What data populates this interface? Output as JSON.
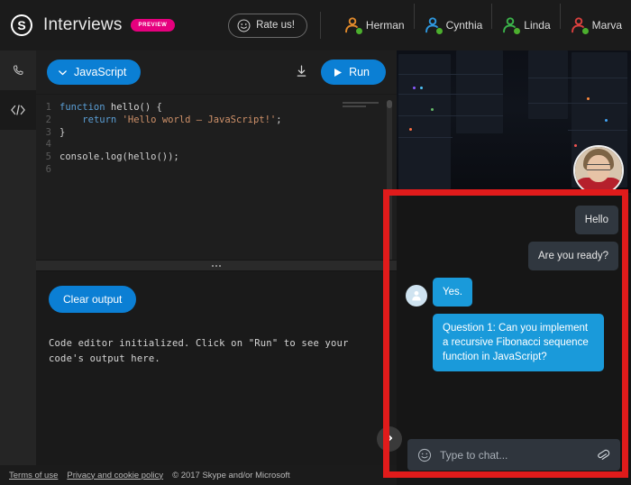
{
  "header": {
    "logo_icon": "skype-logo-icon",
    "title": "Interviews",
    "preview_badge": "PREVIEW",
    "rate_button": "Rate us!",
    "rate_icon": "smiley-icon"
  },
  "participants": [
    {
      "name": "Herman",
      "color": "#e0892b",
      "status": "online"
    },
    {
      "name": "Cynthia",
      "color": "#2e97de",
      "status": "online"
    },
    {
      "name": "Linda",
      "color": "#3bb24a",
      "status": "online"
    },
    {
      "name": "Marva",
      "color": "#d9403e",
      "status": "online"
    }
  ],
  "rail": {
    "items": [
      {
        "name": "call-icon",
        "active": false
      },
      {
        "name": "code-icon",
        "active": true
      }
    ]
  },
  "editor": {
    "language": "JavaScript",
    "language_chevron": "chevron-down-icon",
    "download_icon": "download-icon",
    "run_label": "Run",
    "run_icon": "play-icon",
    "lines": [
      {
        "n": "1",
        "tokens": [
          {
            "t": "function ",
            "c": "kw"
          },
          {
            "t": "hello",
            "c": "fn"
          },
          {
            "t": "() {",
            "c": "pun"
          }
        ]
      },
      {
        "n": "2",
        "tokens": [
          {
            "t": "    ",
            "c": "pun"
          },
          {
            "t": "return ",
            "c": "kw"
          },
          {
            "t": "'Hello world – JavaScript!'",
            "c": "str"
          },
          {
            "t": ";",
            "c": "pun"
          }
        ]
      },
      {
        "n": "3",
        "tokens": [
          {
            "t": "}",
            "c": "pun"
          }
        ]
      },
      {
        "n": "4",
        "tokens": [
          {
            "t": "",
            "c": "pun"
          }
        ]
      },
      {
        "n": "5",
        "tokens": [
          {
            "t": "console.log(hello());",
            "c": "cl"
          }
        ]
      },
      {
        "n": "6",
        "tokens": [
          {
            "t": "",
            "c": "pun"
          }
        ]
      }
    ]
  },
  "output": {
    "clear_label": "Clear output",
    "text": "Code editor initialized. Click on \"Run\" to see your code's output here."
  },
  "video": {
    "main_participant_alt": "interviewee-video",
    "pip_participant_alt": "self-view-video"
  },
  "chat": {
    "messages": [
      {
        "side": "out",
        "text": "Hello",
        "avatar": false
      },
      {
        "side": "out",
        "text": "Are you ready?",
        "avatar": false
      },
      {
        "side": "in",
        "text": "Yes.",
        "avatar": true
      },
      {
        "side": "in",
        "text": "Question 1: Can you implement a recursive Fibonacci sequence function in JavaScript?",
        "avatar": false
      }
    ],
    "input_value": "",
    "input_placeholder": "Type to chat...",
    "emoji_icon": "smiley-icon",
    "attach_icon": "paperclip-icon"
  },
  "collapse": {
    "icon": "chevron-right-icon"
  },
  "footer": {
    "terms": "Terms of use",
    "privacy": "Privacy and cookie policy",
    "copyright": "© 2017 Skype and/or Microsoft"
  },
  "annotation": {
    "color": "#e01b1b"
  }
}
